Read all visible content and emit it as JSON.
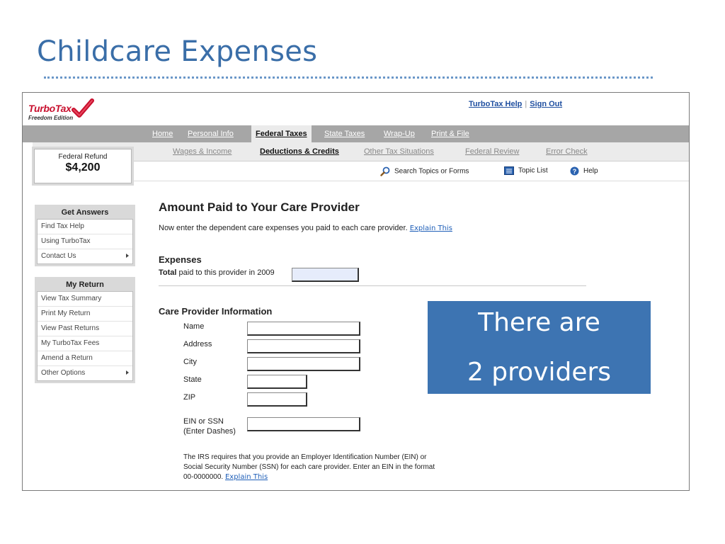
{
  "slide": {
    "title": "Childcare Expenses"
  },
  "app": {
    "logo_text": "TurboTax",
    "logo_sub": "Freedom Edition",
    "top_links": {
      "help": "TurboTax Help",
      "separator": "|",
      "signout": "Sign Out"
    }
  },
  "nav_primary": {
    "home": "Home",
    "personal": "Personal Info",
    "federal": "Federal Taxes",
    "state": "State Taxes",
    "wrapup": "Wrap-Up",
    "print": "Print & File"
  },
  "nav_secondary": {
    "wages": "Wages & Income",
    "deductions": "Deductions & Credits",
    "other": "Other Tax Situations",
    "review": "Federal Review",
    "error": "Error Check"
  },
  "refund": {
    "label": "Federal Refund",
    "amount": "$4,200"
  },
  "tools": {
    "search": "Search Topics or Forms",
    "topics": "Topic List",
    "help": "Help"
  },
  "panels": {
    "answers": {
      "title": "Get Answers",
      "items": [
        "Find Tax Help",
        "Using TurboTax",
        "Contact Us"
      ]
    },
    "myreturn": {
      "title": "My Return",
      "items": [
        "View Tax Summary",
        "Print My Return",
        "View Past Returns",
        "My TurboTax Fees",
        "Amend a Return",
        "Other Options"
      ]
    }
  },
  "main": {
    "heading": "Amount Paid to Your Care Provider",
    "intro": "Now enter the dependent care expenses you paid to each care provider.",
    "explain_link": "Explain This",
    "expenses_heading": "Expenses",
    "total_bold": "Total",
    "total_rest": " paid to this provider in 2009",
    "total_value": "",
    "provider_heading": "Care Provider Information",
    "fields": {
      "name": "Name",
      "address": "Address",
      "city": "City",
      "state": "State",
      "zip": "ZIP",
      "ein_line1": "EIN or SSN",
      "ein_line2": "(Enter Dashes)"
    },
    "note_line1": "The IRS requires that you provide an Employer Identification Number (EIN) or",
    "note_line2": "Social Security Number (SSN) for each care provider. Enter an EIN in the format",
    "note_line3": "00-0000000.",
    "note_link": "Explain This"
  },
  "callout": {
    "line1": "There are",
    "line2": "2 providers"
  },
  "colors": {
    "title_blue": "#3a6ea8",
    "callout_blue": "#3d74b2",
    "link_blue": "#1f4fa0",
    "nav_gray": "#a6a6a6",
    "logo_red": "#c8102e"
  }
}
